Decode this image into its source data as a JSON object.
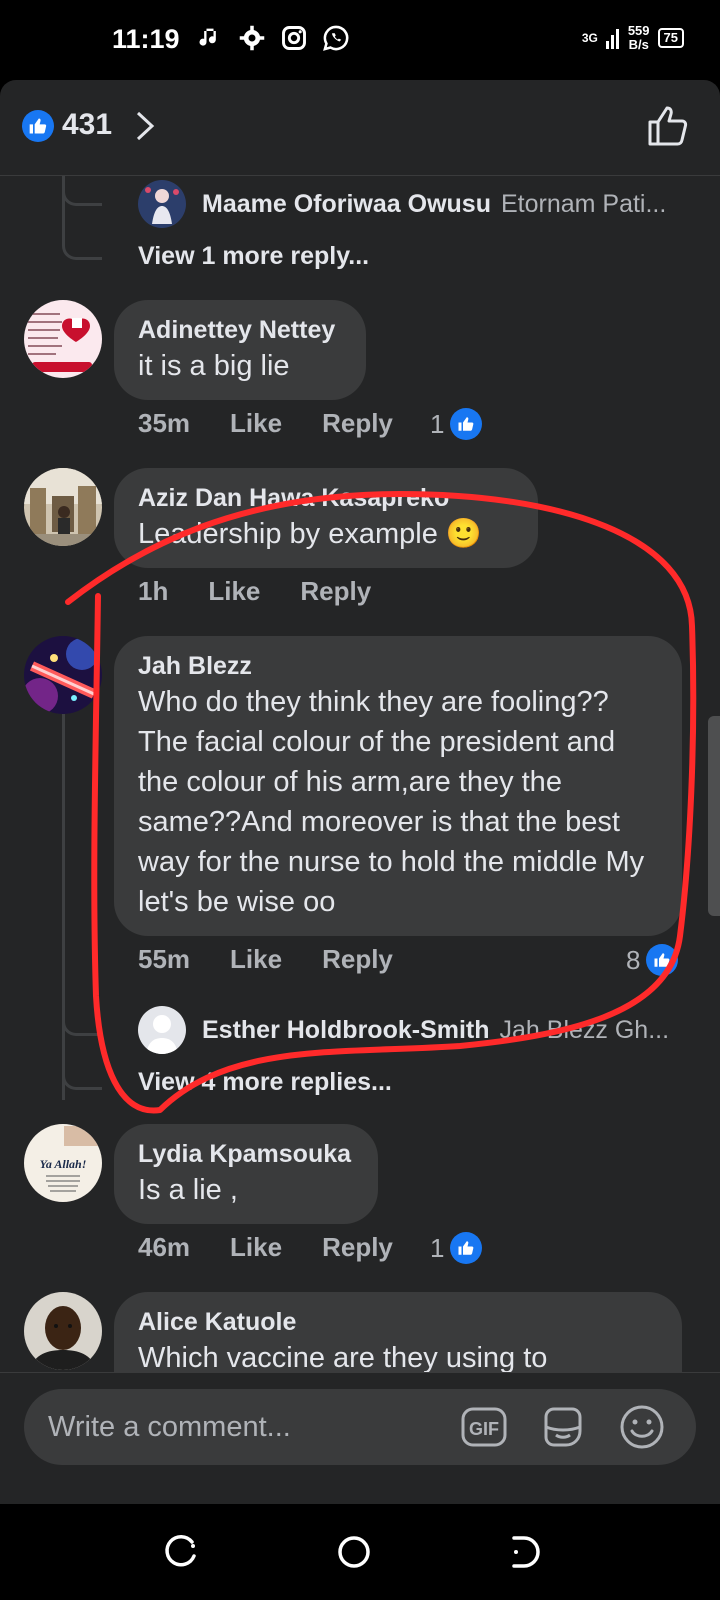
{
  "status_bar": {
    "time": "11:19",
    "net_speed": "559",
    "net_unit": "B/s",
    "signal": "3G",
    "battery": "75"
  },
  "header": {
    "like_count": "431",
    "like_icon": "thumbs-up-icon",
    "chevron_icon": "chevron-right-icon",
    "like_button_icon": "thumbs-up-outline-icon"
  },
  "thread1": {
    "reply": {
      "name": "Maame Oforiwaa Owusu",
      "text": "Etornam Pati..."
    },
    "more": "View 1 more reply..."
  },
  "comments": [
    {
      "name": "Adinettey Nettey",
      "text": "it is a big lie",
      "time": "35m",
      "like": "Like",
      "reply": "Reply",
      "reactions": "1"
    },
    {
      "name": "Aziz Dan Hawa Kasapreko",
      "text": "Leadership by example 🙂",
      "time": "1h",
      "like": "Like",
      "reply": "Reply",
      "reactions": ""
    },
    {
      "name": "Jah Blezz",
      "text": "Who do they think they are fooling?? The facial colour of the president and the colour of his arm,are they the same??And moreover is that the best way for the nurse to hold the middle My let's be wise oo",
      "time": "55m",
      "like": "Like",
      "reply": "Reply",
      "reactions": "8"
    },
    {
      "name": "Lydia Kpamsouka",
      "text": "Is a lie ,",
      "time": "46m",
      "like": "Like",
      "reply": "Reply",
      "reactions": "1"
    },
    {
      "name": "Alice Katuole",
      "text": "Which vaccine are they using to",
      "time": "",
      "like": "",
      "reply": "",
      "reactions": ""
    }
  ],
  "thread3": {
    "reply": {
      "name": "Esther Holdbrook-Smith",
      "text": "Jah Blezz  Gh..."
    },
    "more": "View 4 more replies..."
  },
  "avatar_text": {
    "lydia": "Ya Allah!"
  },
  "composer": {
    "placeholder": "Write a comment...",
    "gif_label": "GIF",
    "sticker_icon": "sticker-icon",
    "emoji_icon": "emoji-icon"
  },
  "colors": {
    "background": "#242526",
    "bubble": "#3a3b3c",
    "accent": "#1877f2",
    "annotation": "#ff2a2a"
  }
}
